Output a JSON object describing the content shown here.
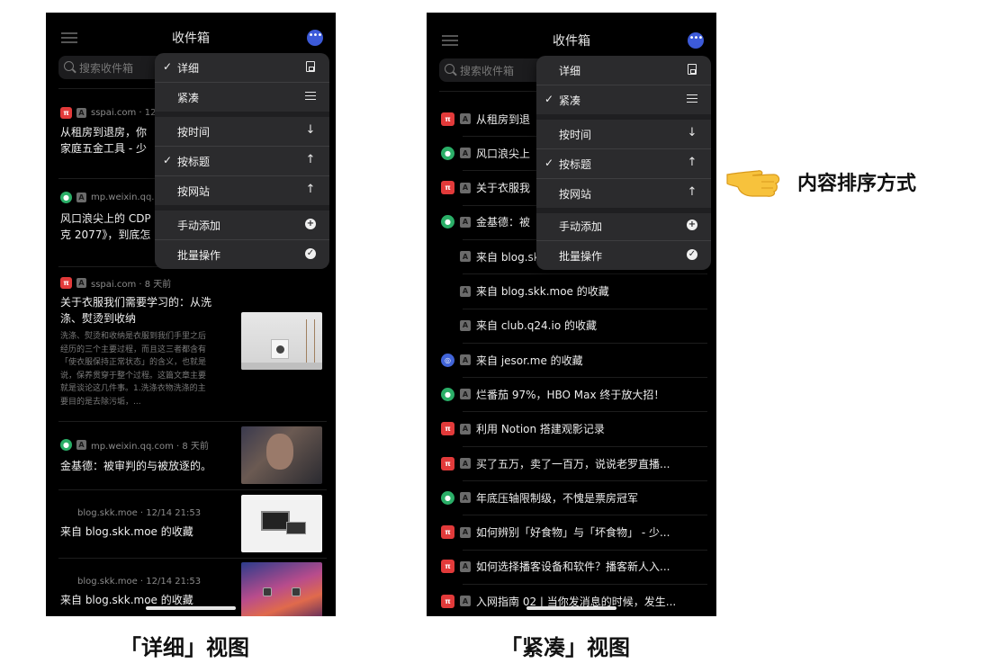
{
  "left_screen": {
    "title": "收件箱",
    "search_placeholder": "搜索收件箱",
    "items": [
      {
        "source": "sspai.com · 12",
        "title_lines": [
          "从租房到退房，你",
          "家庭五金工具 - 少"
        ]
      },
      {
        "source": "mp.weixin.qq.com",
        "title_lines": [
          "风口浪尖上的 CDP",
          "克 2077》，到底怎"
        ]
      },
      {
        "source": "sspai.com · 8 天前",
        "title_lines": [
          "关于衣服我们需要学习的：从洗",
          "涤、熨烫到收纳"
        ],
        "excerpt_lines": [
          "洗涤、熨烫和收纳是衣服到我们手里之后",
          "经历的三个主要过程，而且这三者都含有",
          "「使衣服保持正常状态」的含义，也就是",
          "说，保养贯穿于整个过程。这篇文章主要",
          "就是谈论这几件事。1.洗涤衣物洗涤的主",
          "要目的是去除污垢，..."
        ]
      },
      {
        "source": "mp.weixin.qq.com · 8 天前",
        "title_lines": [
          "金基德：被审判的与被放逐的。"
        ]
      },
      {
        "source": "blog.skk.moe · 12/14 21:53",
        "title_lines": [
          "来自 blog.skk.moe 的收藏"
        ]
      },
      {
        "source": "blog.skk.moe · 12/14 21:53",
        "title_lines": [
          "来自 blog.skk.moe 的收藏"
        ]
      }
    ],
    "menu": {
      "items": [
        {
          "label": "详细",
          "checked": true,
          "icon": "document-icon"
        },
        {
          "label": "紧凑",
          "checked": false,
          "icon": "list-icon"
        },
        {
          "label": "按时间",
          "checked": false,
          "icon": "arrow-down-icon"
        },
        {
          "label": "按标题",
          "checked": true,
          "icon": "arrow-up-icon"
        },
        {
          "label": "按网站",
          "checked": false,
          "icon": "arrow-up-icon"
        },
        {
          "label": "手动添加",
          "checked": false,
          "icon": "plus-circle-icon"
        },
        {
          "label": "批量操作",
          "checked": false,
          "icon": "check-circle-icon"
        }
      ]
    }
  },
  "right_screen": {
    "title": "收件箱",
    "search_placeholder": "搜索收件箱",
    "rows": [
      {
        "favicon": "red",
        "text": "从租房到退"
      },
      {
        "favicon": "green",
        "text": "风口浪尖上"
      },
      {
        "favicon": "red",
        "text": "关于衣服我"
      },
      {
        "favicon": "green",
        "text": "金基德：被"
      },
      {
        "favicon": "none",
        "text": "来自 blog.skk."
      },
      {
        "favicon": "none",
        "text": "来自 blog.skk.moe 的收藏"
      },
      {
        "favicon": "none",
        "text": "来自 club.q24.io 的收藏"
      },
      {
        "favicon": "blue",
        "text": "来自 jesor.me 的收藏"
      },
      {
        "favicon": "green",
        "text": "烂番茄 97%，HBO Max 终于放大招！"
      },
      {
        "favicon": "red",
        "text": "利用 Notion 搭建观影记录"
      },
      {
        "favicon": "red",
        "text": "买了五万，卖了一百万，说说老罗直播..."
      },
      {
        "favicon": "green",
        "text": "年底压轴限制级，不愧是票房冠军"
      },
      {
        "favicon": "red",
        "text": "如何辨别「好食物」与「坏食物」 - 少..."
      },
      {
        "favicon": "red",
        "text": "如何选择播客设备和软件？播客新人入..."
      },
      {
        "favicon": "red",
        "text": "入网指南 02 | 当你发消息的时候，发生..."
      }
    ],
    "menu": {
      "items": [
        {
          "label": "详细",
          "checked": false,
          "icon": "document-icon"
        },
        {
          "label": "紧凑",
          "checked": true,
          "icon": "list-icon"
        },
        {
          "label": "按时间",
          "checked": false,
          "icon": "arrow-down-icon"
        },
        {
          "label": "按标题",
          "checked": true,
          "icon": "arrow-up-icon"
        },
        {
          "label": "按网站",
          "checked": false,
          "icon": "arrow-up-icon"
        },
        {
          "label": "手动添加",
          "checked": false,
          "icon": "plus-circle-icon"
        },
        {
          "label": "批量操作",
          "checked": false,
          "icon": "check-circle-icon"
        }
      ]
    }
  },
  "annotation": {
    "text": "内容排序方式",
    "icon": "pointing-hand-icon"
  },
  "captions": {
    "left": "「详细」视图",
    "right": "「紧凑」视图"
  },
  "glyphs": {
    "check": "✓",
    "arrow_down": "↓",
    "arrow_up": "↑",
    "plus": "+",
    "checkmark": "✓",
    "badge_a": "A",
    "more": "•••"
  }
}
